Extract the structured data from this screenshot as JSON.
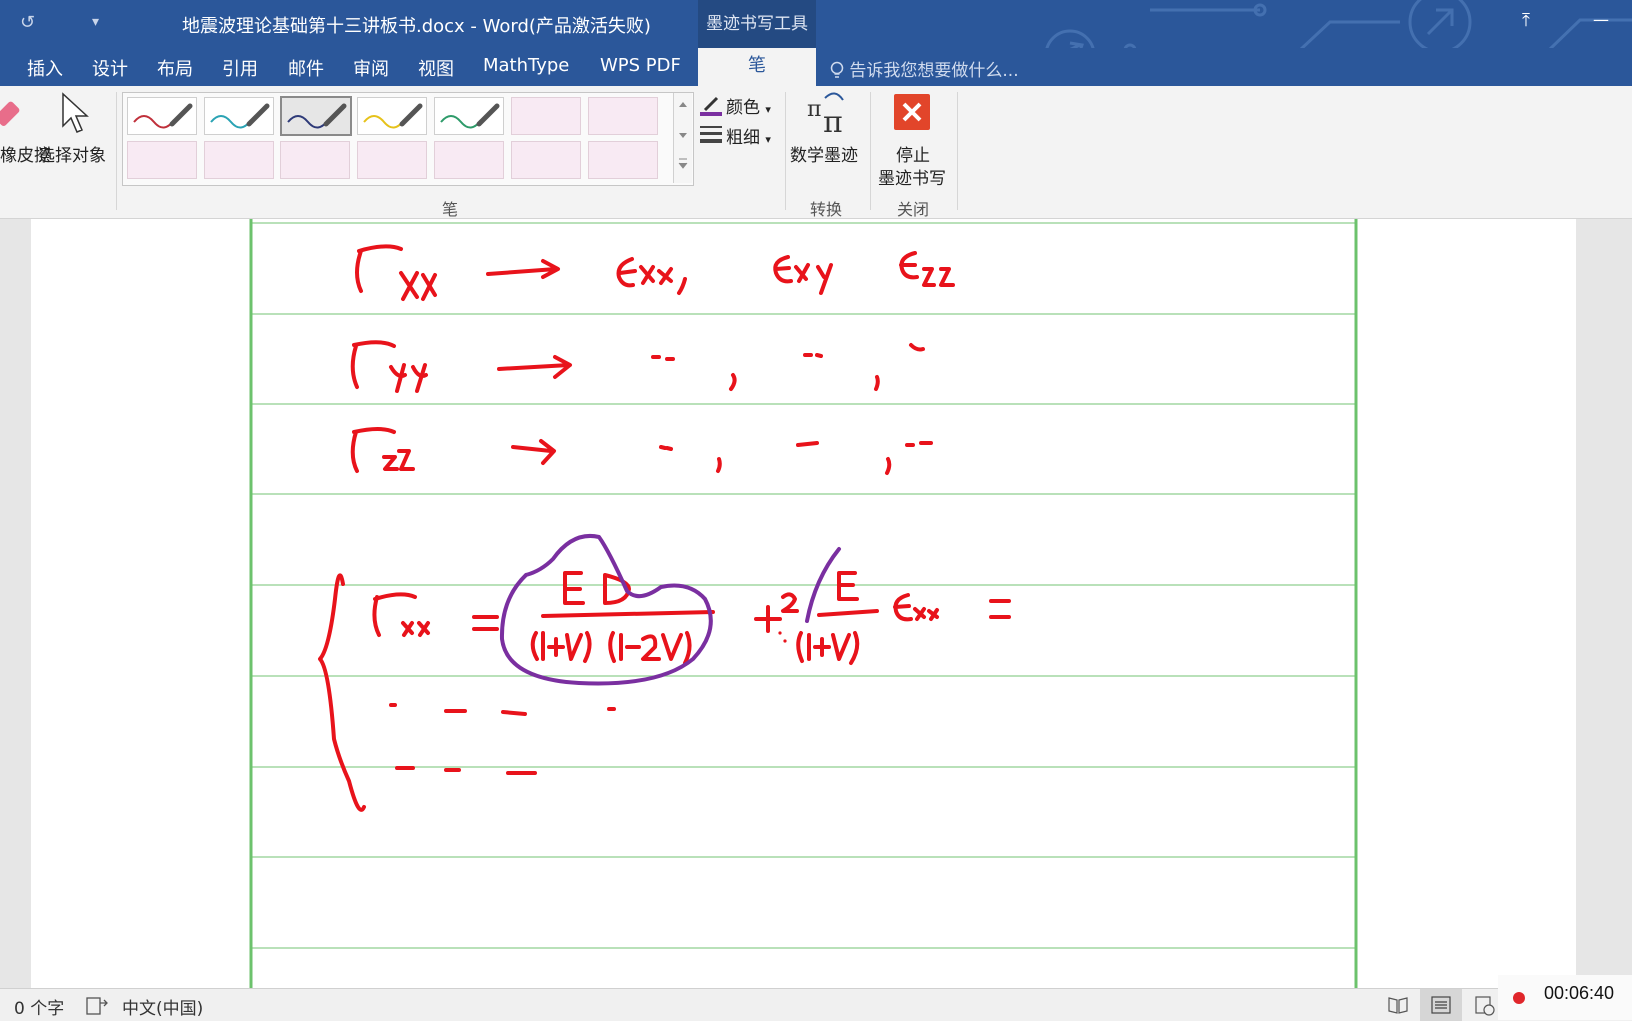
{
  "titlebar": {
    "document_title": "地震波理论基础第十三讲板书.docx - Word(产品激活失败)",
    "context_tool": "墨迹书写工具",
    "undo_glyph": "↺",
    "customize_glyph": "▾",
    "restore_glyph": "⤒",
    "minimize_glyph": "—"
  },
  "tabs": [
    "插入",
    "设计",
    "布局",
    "引用",
    "邮件",
    "审阅",
    "视图",
    "MathType",
    "WPS PDF"
  ],
  "active_tab": "笔",
  "tell_me": "告诉我您想要做什么...",
  "ribbon": {
    "eraser_label": "橡皮擦",
    "select_label": "选择对象",
    "pen_group": "笔",
    "color_label": "颜色",
    "thickness_label": "粗细",
    "math_ink_label": "数学墨迹",
    "convert_group": "转换",
    "stop_line1": "停止",
    "stop_line2": "墨迹书写",
    "close_group": "关闭",
    "pens": [
      {
        "color": "#c0303b",
        "selected": false
      },
      {
        "color": "#2aa3b4",
        "selected": false
      },
      {
        "color": "#2e3a78",
        "selected": true
      },
      {
        "color": "#e6c21a",
        "selected": false
      },
      {
        "color": "#2e9b6a",
        "selected": false
      }
    ]
  },
  "document": {
    "ink_color": "#e8131b",
    "highlight_ink_color": "#7a2fa0",
    "rule_color": "#8fcf8f",
    "margin_color": "#6cc26c"
  },
  "status": {
    "word_count": "0 个字",
    "language": "中文(中国)",
    "record_time": "00:06:40"
  }
}
